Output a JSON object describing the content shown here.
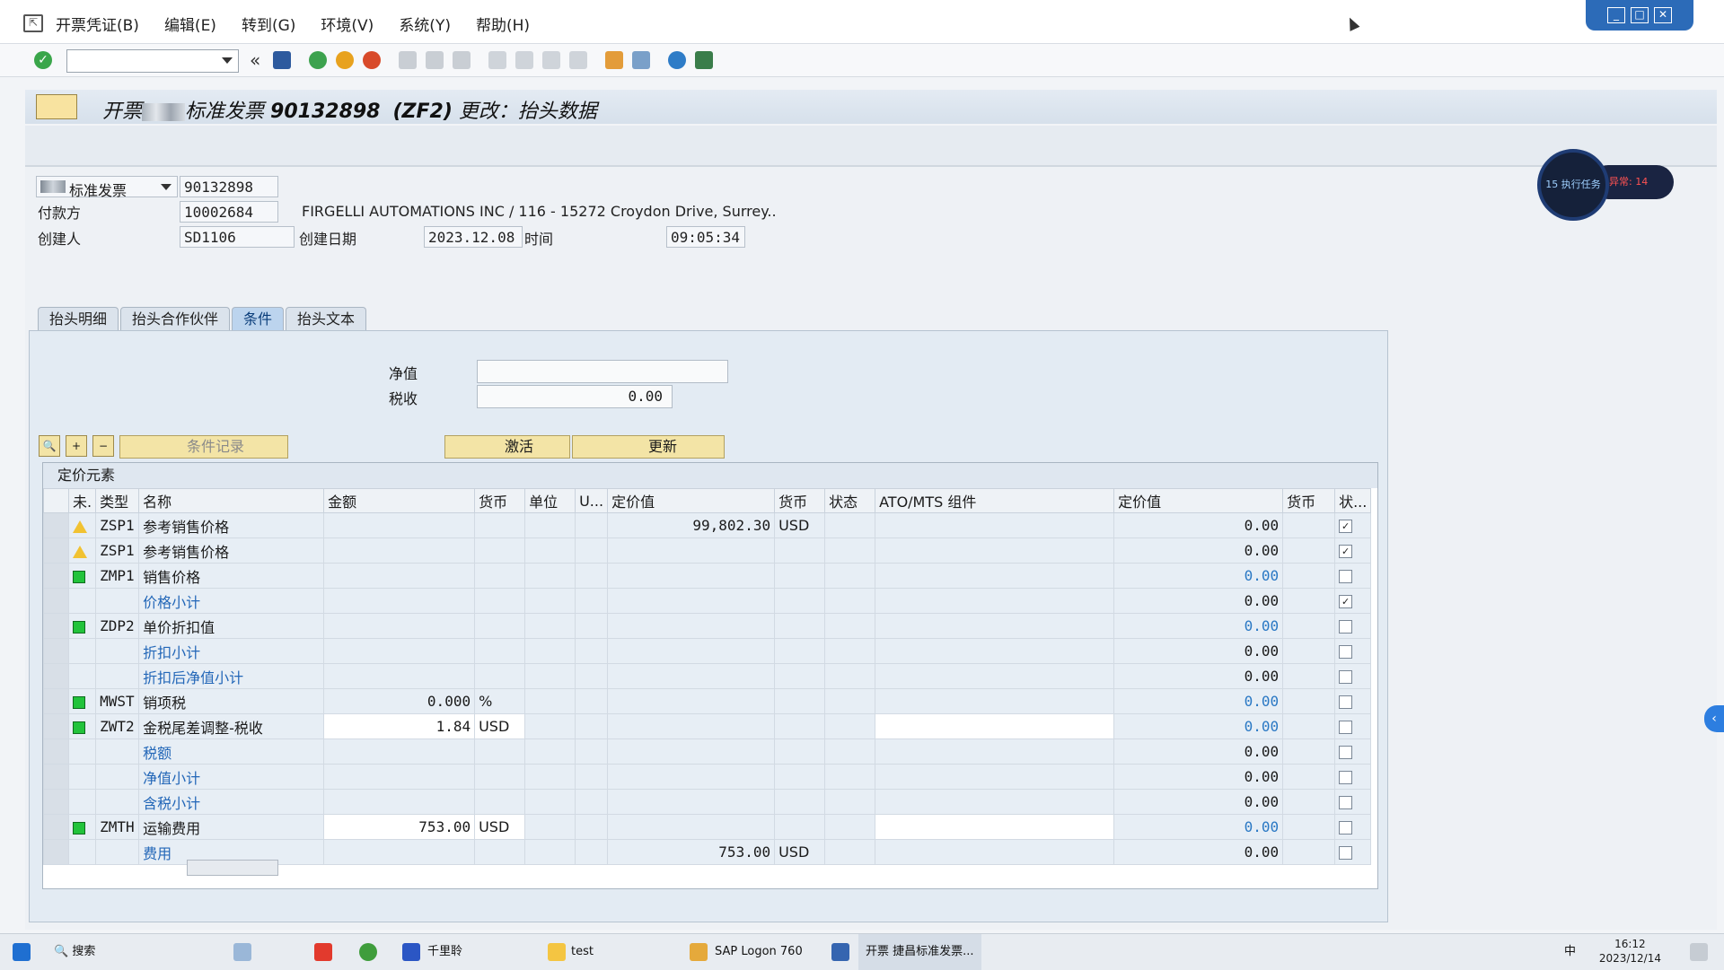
{
  "menu": {
    "items": [
      "开票凭证(B)",
      "编辑(E)",
      "转到(G)",
      "环境(V)",
      "系统(Y)",
      "帮助(H)"
    ]
  },
  "header": {
    "title_prefix": "开票",
    "title_mid": "标准发票",
    "doc_no": "90132898",
    "doc_type": "(ZF2)",
    "title_suffix": "更改：抬头数据"
  },
  "doc": {
    "type_label": "标准发票",
    "type_value": "90132898",
    "payer_label": "付款方",
    "payer_value": "10002684",
    "payer_name": "FIRGELLI AUTOMATIONS INC / 116 - 15272 Croydon Drive, Surrey..",
    "creator_label": "创建人",
    "creator_value": "SD1106",
    "created_on_label": "创建日期",
    "created_on_value": "2023.12.08",
    "time_label": "时间",
    "time_value": "09:05:34"
  },
  "tabs": [
    "抬头明细",
    "抬头合作伙伴",
    "条件",
    "抬头文本"
  ],
  "active_tab": "条件",
  "conditions": {
    "net_label": "净值",
    "net_value": "",
    "tax_label": "税收",
    "tax_value": "0.00",
    "cond_record_label": "条件记录",
    "activate_label": "激活",
    "update_label": "更新"
  },
  "grid": {
    "title": "定价元素",
    "columns": [
      "未.",
      "类型",
      "名称",
      "金额",
      "货币",
      "单位",
      "U...",
      "定价值",
      "货币",
      "状态",
      "ATO/MTS 组件",
      "定价值",
      "货币",
      "状..."
    ],
    "rows": [
      {
        "ind": "warn",
        "type": "ZSP1",
        "name": "参考销售价格",
        "amount": "",
        "curr": "",
        "cond_value": "99,802.30",
        "cond_curr": "USD",
        "value2": "0.00",
        "blue": false,
        "checked": true,
        "white": false
      },
      {
        "ind": "warn",
        "type": "ZSP1",
        "name": "参考销售价格",
        "amount": "",
        "curr": "",
        "cond_value": "",
        "cond_curr": "",
        "value2": "0.00",
        "blue": false,
        "checked": true,
        "white": false
      },
      {
        "ind": "ok",
        "type": "ZMP1",
        "name": "销售价格",
        "amount": "",
        "curr": "",
        "cond_value": "",
        "cond_curr": "",
        "value2": "0.00",
        "blue": true,
        "checked": false,
        "white": false
      },
      {
        "ind": "",
        "type": "",
        "name": "价格小计",
        "amount": "",
        "curr": "",
        "cond_value": "",
        "cond_curr": "",
        "value2": "0.00",
        "blue": false,
        "checked": true,
        "white": false,
        "sub": true
      },
      {
        "ind": "ok",
        "type": "ZDP2",
        "name": "单价折扣值",
        "amount": "",
        "curr": "",
        "cond_value": "",
        "cond_curr": "",
        "value2": "0.00",
        "blue": true,
        "checked": false,
        "white": false
      },
      {
        "ind": "",
        "type": "",
        "name": "折扣小计",
        "amount": "",
        "curr": "",
        "cond_value": "",
        "cond_curr": "",
        "value2": "0.00",
        "blue": false,
        "checked": false,
        "white": false,
        "sub": true
      },
      {
        "ind": "",
        "type": "",
        "name": "折扣后净值小计",
        "amount": "",
        "curr": "",
        "cond_value": "",
        "cond_curr": "",
        "value2": "0.00",
        "blue": false,
        "checked": false,
        "white": false,
        "sub": true
      },
      {
        "ind": "ok",
        "type": "MWST",
        "name": "销项税",
        "amount": "0.000",
        "curr": "%",
        "cond_value": "",
        "cond_curr": "",
        "value2": "0.00",
        "blue": true,
        "checked": false,
        "white": false
      },
      {
        "ind": "ok",
        "type": "ZWT2",
        "name": "金税尾差调整-税收",
        "amount": "1.84",
        "curr": "USD",
        "cond_value": "",
        "cond_curr": "",
        "value2": "0.00",
        "blue": true,
        "checked": false,
        "white": true
      },
      {
        "ind": "",
        "type": "",
        "name": "税额",
        "amount": "",
        "curr": "",
        "cond_value": "",
        "cond_curr": "",
        "value2": "0.00",
        "blue": false,
        "checked": false,
        "white": false,
        "sub": true
      },
      {
        "ind": "",
        "type": "",
        "name": "净值小计",
        "amount": "",
        "curr": "",
        "cond_value": "",
        "cond_curr": "",
        "value2": "0.00",
        "blue": false,
        "checked": false,
        "white": false,
        "sub": true
      },
      {
        "ind": "",
        "type": "",
        "name": "含税小计",
        "amount": "",
        "curr": "",
        "cond_value": "",
        "cond_curr": "",
        "value2": "0.00",
        "blue": false,
        "checked": false,
        "white": false,
        "sub": true
      },
      {
        "ind": "ok",
        "type": "ZMTH",
        "name": "运输费用",
        "amount": "753.00",
        "curr": "USD",
        "cond_value": "",
        "cond_curr": "",
        "value2": "0.00",
        "blue": true,
        "checked": false,
        "white": true
      },
      {
        "ind": "",
        "type": "",
        "name": "费用",
        "amount": "",
        "curr": "",
        "cond_value": "753.00",
        "cond_curr": "USD",
        "value2": "0.00",
        "blue": false,
        "checked": false,
        "white": false,
        "sub": true
      }
    ]
  },
  "widget": {
    "count": "15",
    "task": "执行任务",
    "alert": "异常: 14"
  },
  "taskbar": {
    "search": "搜索",
    "apps": [
      "千里聆",
      "test",
      "SAP Logon 760",
      "开票 捷昌标准发票..."
    ],
    "time": "16:12",
    "date": "2023/12/14",
    "ime": "中"
  }
}
